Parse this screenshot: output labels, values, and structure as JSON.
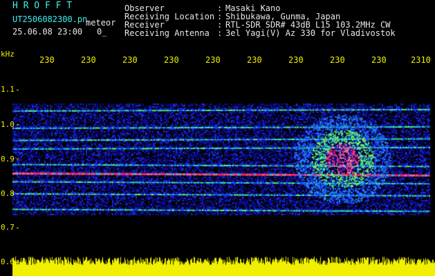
{
  "header": {
    "brand": "H R O F F T",
    "filename": "UT2506082300.pn",
    "mode": "meteor",
    "datetime": "25.06.08 23:00",
    "counter": "0_",
    "fields": [
      {
        "label": "Observer",
        "value": "Masaki Kano"
      },
      {
        "label": "Receiving Location",
        "value": "Shibukawa, Gunma, Japan"
      },
      {
        "label": "Receiver",
        "value": "RTL-SDR SDR# 43dB L15 103.2MHz CW"
      },
      {
        "label": "Receiving Antenna",
        "value": "3el Yagi(V) Az 330 for Vladivostok"
      }
    ]
  },
  "colors": {
    "header_text": "#3ff0f0",
    "axis_text": "#f0f000",
    "background": "#000000",
    "noise_floor": "#0a0a7a",
    "signal_mid": "#20d0d0",
    "signal_high": "#ff2060"
  },
  "chart_data": {
    "type": "heatmap",
    "y_unit": "kHz",
    "y_ticks": [
      "1.1",
      "1.0",
      "0.9",
      "0.8",
      "0.7",
      "0.6"
    ],
    "x_ticks": [
      "230",
      "230",
      "230",
      "230",
      "230",
      "230",
      "230",
      "230",
      "230",
      "2310"
    ],
    "bands_khz": [
      1.04,
      0.99,
      0.955,
      0.93,
      0.885,
      0.86,
      0.835,
      0.8,
      0.755
    ],
    "meteor_echo": {
      "center_khz": 0.88,
      "note": "strong head echo around 23:07"
    }
  }
}
